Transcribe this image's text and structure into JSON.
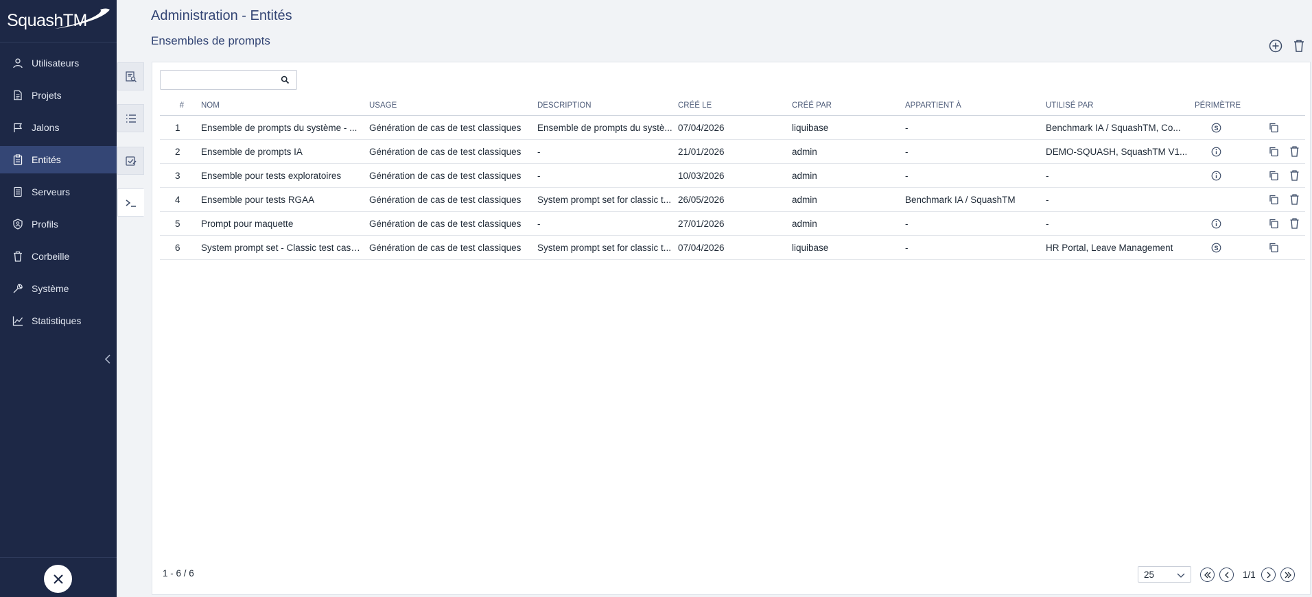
{
  "app": {
    "logo_text": "SquashTM"
  },
  "sidebar": {
    "items": [
      {
        "label": "Utilisateurs",
        "icon": "user-icon"
      },
      {
        "label": "Projets",
        "icon": "file-icon"
      },
      {
        "label": "Jalons",
        "icon": "flag-icon"
      },
      {
        "label": "Entités",
        "icon": "clipboard-icon",
        "active": true
      },
      {
        "label": "Serveurs",
        "icon": "server-icon"
      },
      {
        "label": "Profils",
        "icon": "shield-user-icon"
      },
      {
        "label": "Corbeille",
        "icon": "trash-icon"
      },
      {
        "label": "Système",
        "icon": "wrench-icon"
      },
      {
        "label": "Statistiques",
        "icon": "chart-line-icon"
      }
    ]
  },
  "header": {
    "title": "Administration - Entités",
    "section": "Ensembles de prompts"
  },
  "search": {
    "placeholder": ""
  },
  "table": {
    "columns": [
      "#",
      "NOM",
      "USAGE",
      "DESCRIPTION",
      "CRÉÉ LE",
      "CRÉÉ PAR",
      "APPARTIENT À",
      "UTILISÉ PAR",
      "PÉRIMÈTRE"
    ],
    "rows": [
      {
        "num": "1",
        "nom": "Ensemble de prompts du système - ...",
        "usage": "Génération de cas de test classiques",
        "description": "Ensemble de prompts du systè...",
        "cree_le": "07/04/2026",
        "cree_par": "liquibase",
        "appartient": "-",
        "utilise_par": "Benchmark IA / SquashTM, Co...",
        "perimetre": "system",
        "deletable": false
      },
      {
        "num": "2",
        "nom": "Ensemble de prompts IA",
        "usage": "Génération de cas de test classiques",
        "description": "-",
        "cree_le": "21/01/2026",
        "cree_par": "admin",
        "appartient": "-",
        "utilise_par": "DEMO-SQUASH, SquashTM V1...",
        "perimetre": "info",
        "deletable": true
      },
      {
        "num": "3",
        "nom": "Ensemble pour tests exploratoires",
        "usage": "Génération de cas de test classiques",
        "description": "-",
        "cree_le": "10/03/2026",
        "cree_par": "admin",
        "appartient": "-",
        "utilise_par": "-",
        "perimetre": "info",
        "deletable": true
      },
      {
        "num": "4",
        "nom": "Ensemble pour tests RGAA",
        "usage": "Génération de cas de test classiques",
        "description": "System prompt set for classic t...",
        "cree_le": "26/05/2026",
        "cree_par": "admin",
        "appartient": "Benchmark IA / SquashTM",
        "utilise_par": "-",
        "perimetre": "none",
        "deletable": true
      },
      {
        "num": "5",
        "nom": "Prompt pour maquette",
        "usage": "Génération de cas de test classiques",
        "description": "-",
        "cree_le": "27/01/2026",
        "cree_par": "admin",
        "appartient": "-",
        "utilise_par": "-",
        "perimetre": "info",
        "deletable": true
      },
      {
        "num": "6",
        "nom": "System prompt set - Classic test case...",
        "usage": "Génération de cas de test classiques",
        "description": "System prompt set for classic t...",
        "cree_le": "07/04/2026",
        "cree_par": "liquibase",
        "appartient": "-",
        "utilise_par": "HR Portal, Leave Management",
        "perimetre": "system",
        "deletable": false
      }
    ]
  },
  "footer": {
    "count": "1 - 6 / 6",
    "page_size": "25",
    "page_info": "1/1"
  },
  "colors": {
    "sidebar_bg": "#1d2846",
    "active_item_bg": "#344675",
    "title_color": "#344675"
  }
}
